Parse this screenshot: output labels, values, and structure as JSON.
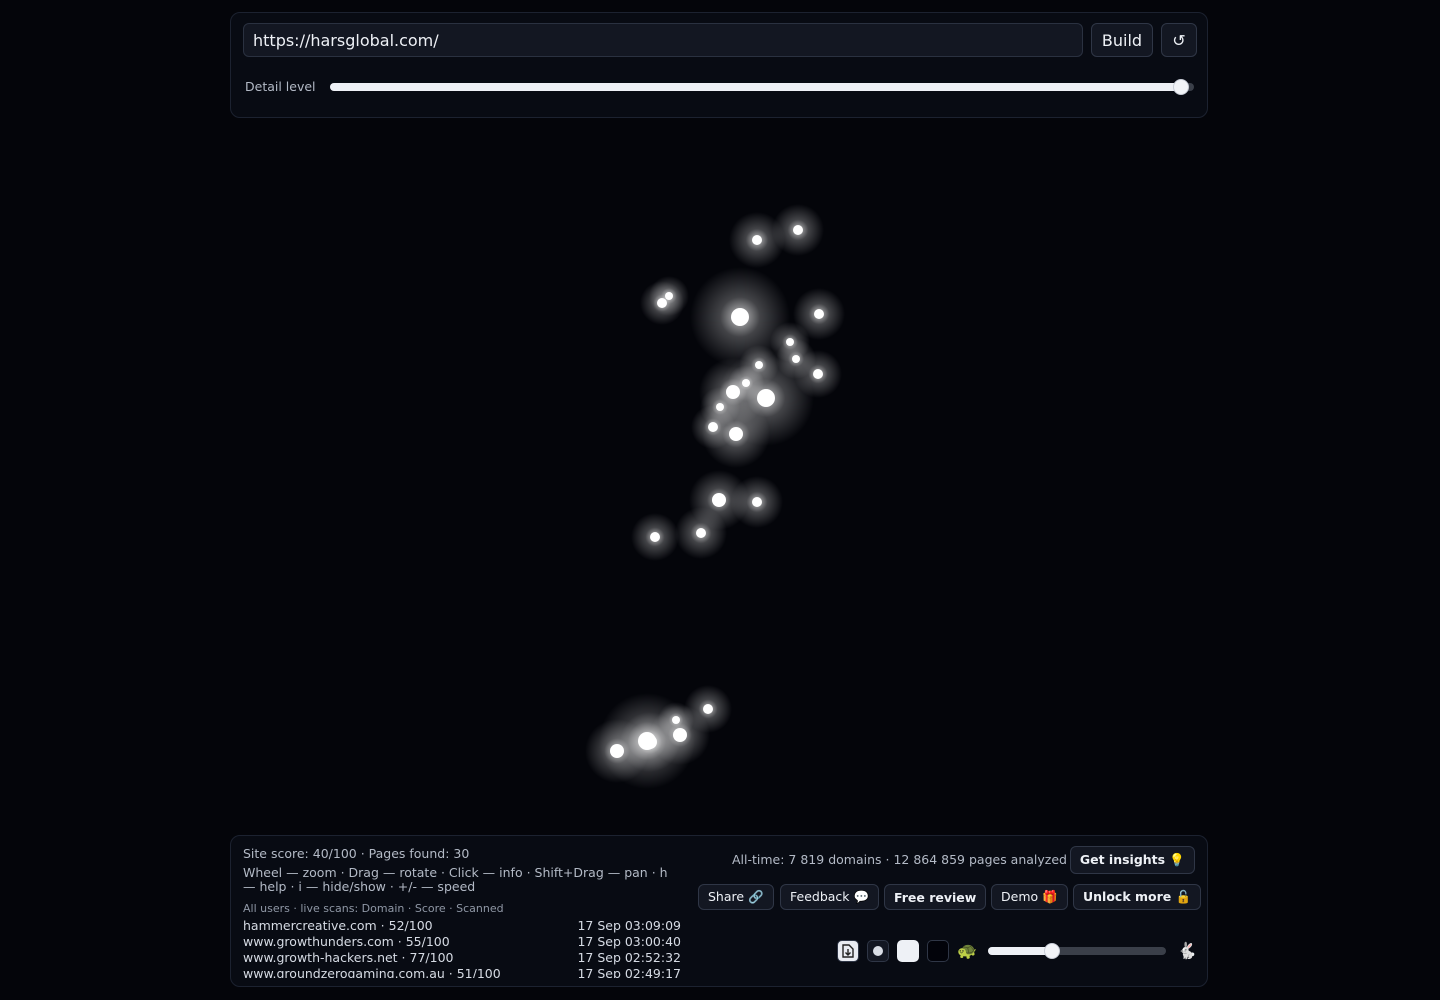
{
  "url": {
    "value": "https://harsglobal.com/",
    "placeholder": ""
  },
  "toolbar": {
    "build_label": "Build",
    "reset_label": "↺"
  },
  "detail": {
    "label": "Detail level",
    "level": 0.985
  },
  "stats": {
    "site": "Site score: 40/100 · Pages found: 30",
    "help": "Wheel — zoom · Drag — rotate · Click — info · Shift+Drag — pan · h — help · i — hide/show · +/- — speed",
    "alltime": "All-time: 7 819 domains · 12 864 859 pages analyzed"
  },
  "scans": {
    "title": "All users · live scans: Domain · Score · Scanned",
    "rows": [
      {
        "domain": "hammercreative.com · 52/100",
        "time": "17 Sep 03:09:09"
      },
      {
        "domain": "www.growthunders.com · 55/100",
        "time": "17 Sep 03:00:40"
      },
      {
        "domain": "www.growth-hackers.net · 77/100",
        "time": "17 Sep 02:52:32"
      },
      {
        "domain": "www.groundzerogaming.com.au · 51/100",
        "time": "17 Sep 02:49:17"
      }
    ]
  },
  "buttons": {
    "insights": "Get insights 💡",
    "share": "Share 🔗",
    "feedback": "Feedback 💬",
    "review": "Free review",
    "demo": "Demo 🎁",
    "unlock": "Unlock more 🔓"
  },
  "controls": {
    "export_icon": "export-icon",
    "slow_icon": "🐢",
    "fast_icon": "🐇",
    "speed_level": 0.36
  },
  "colors": {
    "background": "#04050a",
    "node": "#ffffff",
    "accent": "#eef1f6"
  }
}
